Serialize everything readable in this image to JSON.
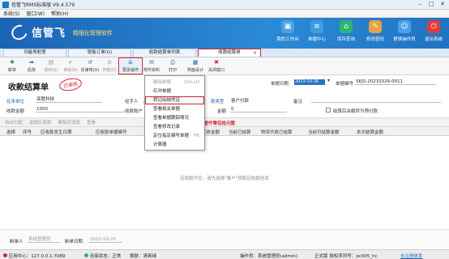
{
  "window": {
    "title": "信管飞RMS标准版 V9.4.579",
    "min": "–",
    "max": "□",
    "close": "✕"
  },
  "menubar": [
    "系统(S)",
    "窗口(W)",
    "帮助(H)"
  ],
  "banner": {
    "brand": "信管飞",
    "subtitle": "精细化管理软件",
    "buttons": [
      {
        "label": "我的工作台",
        "icon": "monitor-icon",
        "color": "#4aa3e8",
        "glyph": "▣"
      },
      {
        "label": "单据中心",
        "icon": "document-icon",
        "color": "#3b9ee0",
        "glyph": "≡"
      },
      {
        "label": "库存查询",
        "icon": "warehouse-icon",
        "color": "#2bb673",
        "glyph": "⌂"
      },
      {
        "label": "修改密码",
        "icon": "lock-icon",
        "color": "#e8a13b",
        "glyph": "✎"
      },
      {
        "label": "更换操作员",
        "icon": "user-switch-icon",
        "color": "#4aa3e8",
        "glyph": "☺"
      },
      {
        "label": "退出系统",
        "icon": "exit-icon",
        "color": "#e23b3b",
        "glyph": "⏻"
      }
    ]
  },
  "tabs": [
    {
      "label": "功能导航室",
      "active": false
    },
    {
      "label": "销售订单(G)",
      "active": false
    },
    {
      "label": "收款结算单列表",
      "active": false
    },
    {
      "label": "收款结算单",
      "active": true,
      "close": "×"
    }
  ],
  "toolbar": [
    {
      "label": "新单",
      "icon": "new-icon",
      "glyph": "✚",
      "color": "#2b8a3e",
      "dim": false
    },
    {
      "label": "后单",
      "icon": "next-icon",
      "glyph": "➡",
      "color": "#1b64b5",
      "dim": false
    },
    {
      "label": "保存(S)",
      "icon": "save-icon",
      "glyph": "▤",
      "color": "#999",
      "dim": true
    },
    {
      "label": "审核(A)",
      "icon": "audit-icon",
      "glyph": "✔",
      "color": "#999",
      "dim": true
    },
    {
      "label": "反审核(U)",
      "icon": "unaudit-icon",
      "glyph": "↺",
      "color": "#1b64b5",
      "dim": false
    },
    {
      "label": "作废(D)",
      "icon": "void-icon",
      "glyph": "⊘",
      "color": "#999",
      "dim": true
    },
    {
      "label": "更多操作",
      "icon": "more-icon",
      "glyph": "⇊",
      "color": "#1b64b5",
      "dim": false,
      "hl": true
    },
    {
      "label": "附件资料",
      "icon": "attachment-icon",
      "glyph": "✉",
      "color": "#1b64b5",
      "dim": false
    },
    {
      "label": "打印",
      "icon": "printer-icon",
      "glyph": "⎙",
      "color": "#1b64b5",
      "dim": false
    },
    {
      "label": "界面设计",
      "icon": "design-icon",
      "glyph": "▦",
      "color": "#1b64b5",
      "dim": false
    },
    {
      "label": "关闭窗口",
      "icon": "close-window-icon",
      "glyph": "✖",
      "color": "#d9232a",
      "dim": false
    }
  ],
  "header": {
    "title": "收款结算单",
    "stamp": "已审核",
    "date_label": "单据日期",
    "date_value": "2023-10-26",
    "docno_label": "单据编号",
    "docno_value": "SKJS-20231026-0011",
    "dealer_label": "往来单位",
    "dealer_value": "亚胜科技",
    "handler_label": "经手人",
    "cust_pay_label": "客户付款",
    "remark_label": "备注",
    "amount_label": "收款金额",
    "amount_value": "1050",
    "account_label": "收款账户",
    "cust_pay_value": "0",
    "cust_type_label": "款类型",
    "deduct_label": "金额",
    "settle_check_label": "结算后余额转为预付款"
  },
  "subbar": [
    "自动分配",
    "选择应收款",
    "删除应收款",
    "查看"
  ],
  "summary_text": "合计金额：(大写)壹仟零伍拾元整",
  "grid_columns": [
    "选择",
    "序号",
    "应收款发生日期",
    "应收款单据编号",
    "物流代收金额",
    "当前已结算",
    "物流代收已结算",
    "当前可结算金额",
    "本次结算金额"
  ],
  "empty_message": "应收款为空，请先选择\"客户\"获取应收款信息",
  "footer": {
    "maker_label": "制单人",
    "maker_value": "系统管理员",
    "make_date_label": "制单日期",
    "make_date_value": "2023-10-26"
  },
  "status": {
    "center": "应用中心：127.0.0.1:7089",
    "connection": "连接状态：正常",
    "skin": "换肤：清爽绿",
    "operator": "操作员：系统管理员(admin)",
    "edition": "正式版 授权序列号：pc005_hc",
    "register": "去注册体系"
  },
  "dropdown": [
    {
      "label": "删除单据",
      "shortcut": "Ctrl+D",
      "dim": true,
      "hl": false
    },
    {
      "label": "红冲单据",
      "shortcut": "",
      "dim": false,
      "hl": false
    },
    {
      "label": "转记出纳凭证",
      "shortcut": "",
      "dim": false,
      "hl": true
    },
    {
      "label": "查看相关单据",
      "shortcut": "",
      "dim": false,
      "hl": false
    },
    {
      "label": "查看单据跟踪情况",
      "shortcut": "",
      "dim": false,
      "hl": false
    },
    {
      "label": "查看修改记录",
      "shortcut": "",
      "dim": false,
      "hl": false
    },
    {
      "label": "定位指定编号单据",
      "shortcut": "F6",
      "dim": false,
      "hl": false
    },
    {
      "label": "计算器",
      "shortcut": "",
      "dim": false,
      "hl": false
    }
  ]
}
